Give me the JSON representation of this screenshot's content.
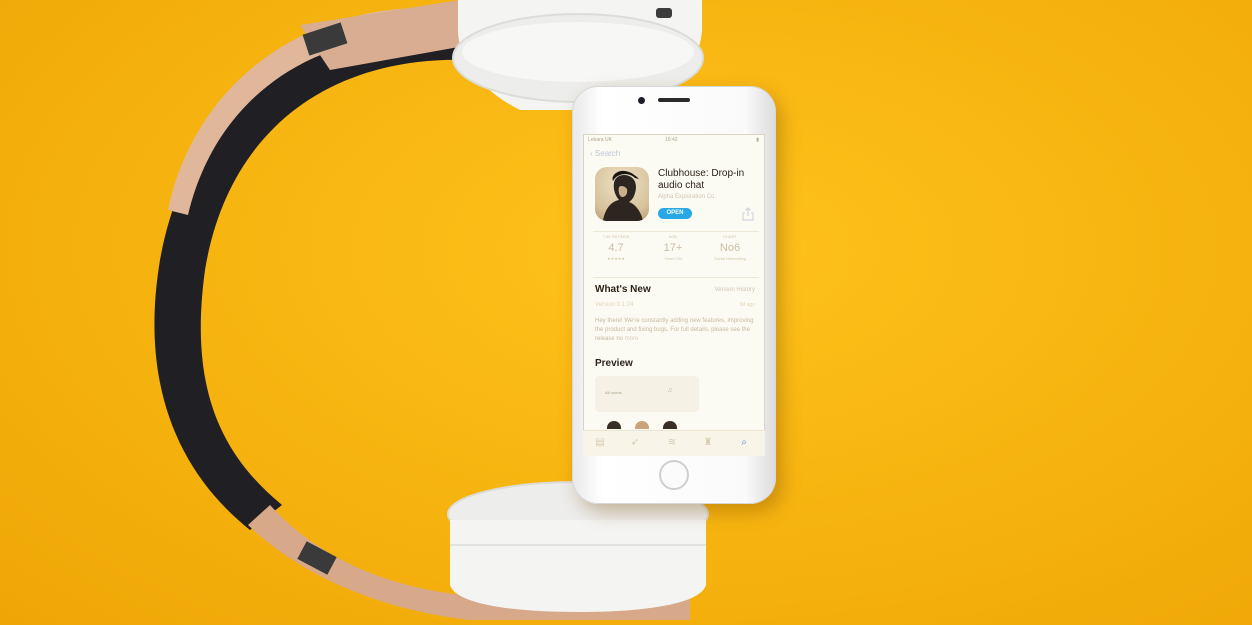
{
  "scene": {
    "background_color": "#f7b512",
    "headphone_band_color": "#1f1f24",
    "headphone_cup_color": "#f4f4f2",
    "rose_gold_color": "#d7a98a"
  },
  "phone": {
    "status_bar": {
      "carrier": "Lebara UK",
      "time": "16:42"
    },
    "back_label": "Search",
    "app": {
      "title": "Clubhouse: Drop-in audio chat",
      "developer": "Alpha Exploration Co.",
      "open_label": "OPEN"
    },
    "stats": [
      {
        "label": "7.6K RATINGS",
        "value": "4.7",
        "sub": "★★★★★"
      },
      {
        "label": "AGE",
        "value": "17+",
        "sub": "Years Old"
      },
      {
        "label": "CHART",
        "value": "No6",
        "sub": "Social Networking"
      }
    ],
    "whats_new": {
      "title": "What's New",
      "history_link": "Version History",
      "version": "Version 0.1.24",
      "age": "5d ago",
      "notes": "Hey there! We're constantly adding new features, improving the product and fixing bugs. For full details, please see the release no",
      "more": "more"
    },
    "preview": {
      "title": "Preview",
      "card_text": "All rooms"
    },
    "tabbar": {
      "items": [
        "today-icon",
        "games-icon",
        "apps-icon",
        "arcade-icon",
        "search-icon"
      ],
      "active": "search-icon"
    }
  }
}
